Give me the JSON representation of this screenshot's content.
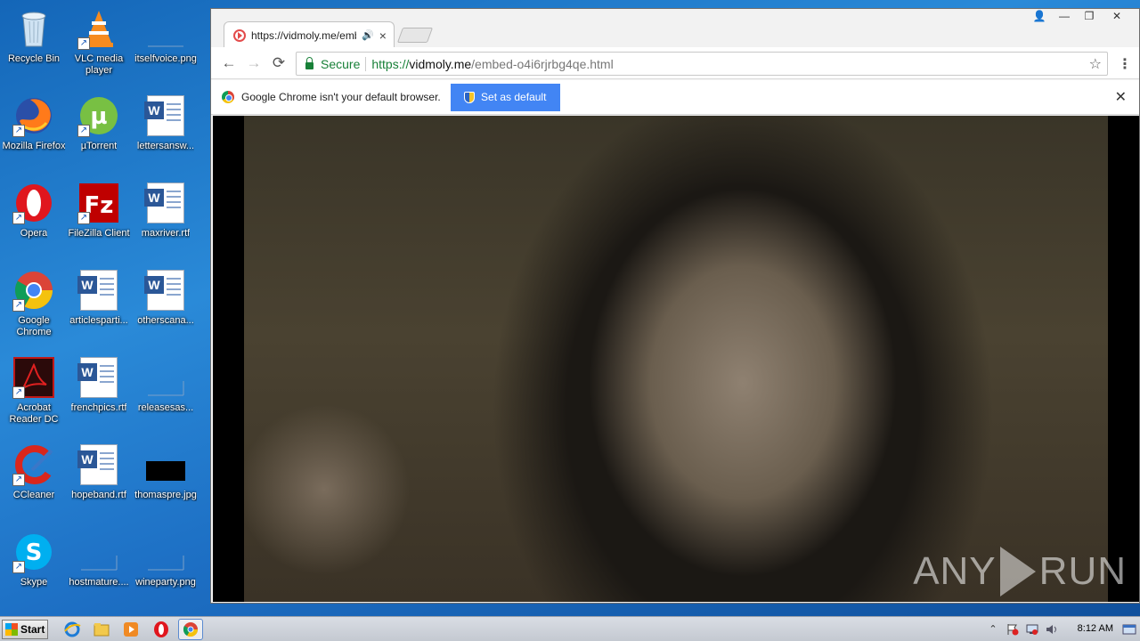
{
  "desktop": {
    "icons": [
      {
        "label": "Recycle Bin",
        "icon": "recycle-bin-icon"
      },
      {
        "label": "VLC media player",
        "icon": "vlc-icon"
      },
      {
        "label": "itselfvoice.png",
        "icon": "image-file-icon"
      },
      {
        "label": "Mozilla Firefox",
        "icon": "firefox-icon"
      },
      {
        "label": "µTorrent",
        "icon": "utorrent-icon"
      },
      {
        "label": "lettersansw...",
        "icon": "word-document-icon"
      },
      {
        "label": "Opera",
        "icon": "opera-icon"
      },
      {
        "label": "FileZilla Client",
        "icon": "filezilla-icon"
      },
      {
        "label": "maxriver.rtf",
        "icon": "word-document-icon"
      },
      {
        "label": "Google Chrome",
        "icon": "chrome-icon"
      },
      {
        "label": "articlesparti...",
        "icon": "word-document-icon"
      },
      {
        "label": "otherscana...",
        "icon": "word-document-icon"
      },
      {
        "label": "Acrobat Reader DC",
        "icon": "acrobat-icon"
      },
      {
        "label": "frenchpics.rtf",
        "icon": "word-document-icon"
      },
      {
        "label": "releasesas...",
        "icon": "image-file-icon"
      },
      {
        "label": "CCleaner",
        "icon": "ccleaner-icon"
      },
      {
        "label": "hopeband.rtf",
        "icon": "word-document-icon"
      },
      {
        "label": "thomaspre.jpg",
        "icon": "image-file-icon"
      },
      {
        "label": "Skype",
        "icon": "skype-icon"
      },
      {
        "label": "hostmature....",
        "icon": "image-file-icon"
      },
      {
        "label": "wineparty.png",
        "icon": "image-file-icon"
      }
    ]
  },
  "browser": {
    "tab": {
      "title": "https://vidmoly.me/emb",
      "close": "×",
      "audio": "🔊"
    },
    "window_controls": {
      "user": "👤",
      "minimize": "—",
      "restore": "❐",
      "close": "✕"
    },
    "nav": {
      "back": "←",
      "forward": "→",
      "reload": "⟳"
    },
    "omnibox": {
      "secure_label": "Secure",
      "url_scheme": "https://",
      "url_host": "vidmoly.me",
      "url_path": "/embed-o4i6rjrbg4qe.html",
      "star": "☆"
    },
    "menu": "⋮",
    "infobar": {
      "message": "Google Chrome isn't your default browser.",
      "button": "Set as default",
      "close": "✕"
    },
    "video": {
      "watermark_left": "ANY",
      "watermark_right": "RUN"
    }
  },
  "taskbar": {
    "start_label": "Start",
    "clock": "8:12 AM",
    "tray_expand": "⌃"
  },
  "colors": {
    "accent": "#4285f4",
    "secure_green": "#188038",
    "desktop_blue": "#1d6fc4"
  }
}
